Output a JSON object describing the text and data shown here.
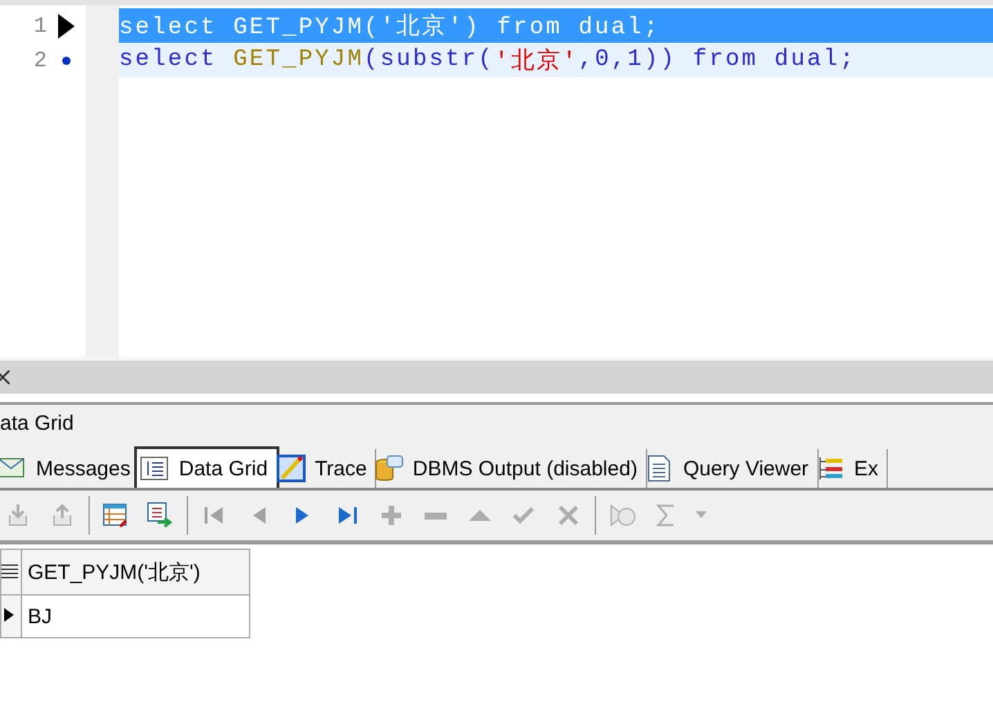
{
  "editor": {
    "lines": [
      {
        "number": "1",
        "kind": "arrow",
        "selected": true,
        "tokens": [
          {
            "kind": "plain",
            "text": "select GET_PYJM('北京') from dual;"
          }
        ]
      },
      {
        "number": "2",
        "kind": "dot",
        "selected": false,
        "tokens": [
          {
            "kind": "keyword",
            "text": "select "
          },
          {
            "kind": "function",
            "text": "GET_PYJM"
          },
          {
            "kind": "plain",
            "text": "(substr("
          },
          {
            "kind": "string",
            "text": "'北京'"
          },
          {
            "kind": "plain",
            "text": ",0,1)) "
          },
          {
            "kind": "keyword",
            "text": "from dual;"
          }
        ]
      }
    ]
  },
  "results_panel": {
    "title": "ata Grid",
    "tabs": [
      {
        "label": "Messages",
        "kind": "messages",
        "selected": false
      },
      {
        "label": "Data Grid",
        "kind": "grid",
        "selected": true
      },
      {
        "label": "Trace",
        "kind": "trace",
        "selected": false
      },
      {
        "label": "DBMS Output (disabled)",
        "kind": "dbms",
        "selected": false
      },
      {
        "label": "Query Viewer",
        "kind": "query",
        "selected": false
      },
      {
        "label": "Ex",
        "kind": "explain",
        "selected": false
      }
    ],
    "toolbar": [
      {
        "kind": "import",
        "disabled": true
      },
      {
        "kind": "export",
        "disabled": true
      },
      {
        "kind": "separator"
      },
      {
        "kind": "grid-refresh",
        "disabled": false
      },
      {
        "kind": "grid-export",
        "disabled": false
      },
      {
        "kind": "separator"
      },
      {
        "kind": "first",
        "disabled": true
      },
      {
        "kind": "prev",
        "disabled": true
      },
      {
        "kind": "next",
        "disabled": false
      },
      {
        "kind": "last",
        "disabled": false
      },
      {
        "kind": "add",
        "disabled": true
      },
      {
        "kind": "remove",
        "disabled": true
      },
      {
        "kind": "up",
        "disabled": true
      },
      {
        "kind": "check",
        "disabled": true
      },
      {
        "kind": "cancel",
        "disabled": true
      },
      {
        "kind": "separator"
      },
      {
        "kind": "clear",
        "disabled": true
      },
      {
        "kind": "sum",
        "disabled": true
      },
      {
        "kind": "dropdown",
        "disabled": true
      }
    ],
    "grid": {
      "columns": [
        "GET_PYJM('北京')"
      ],
      "rows": [
        {
          "cells": [
            "BJ"
          ],
          "selected": true
        }
      ]
    }
  }
}
